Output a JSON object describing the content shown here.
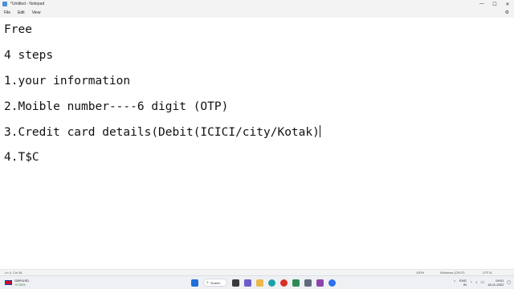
{
  "window": {
    "title": "*Untitled - Notepad",
    "controls": {
      "minimize": "—",
      "maximize": "☐",
      "close": "✕"
    }
  },
  "menu": {
    "file": "File",
    "edit": "Edit",
    "view": "View",
    "settings_icon": "gear-icon"
  },
  "document": {
    "lines": [
      "Free",
      "4 steps",
      "1.your information",
      "2.Moible number----6 digit (OTP)",
      "3.Credit card details(Debit(ICICI/city/Kotak)",
      "4.T$C"
    ]
  },
  "status": {
    "position": "Ln 4, Col 46",
    "zoom": "100%",
    "line_ending": "Windows (CRLF)",
    "encoding": "UTF-8"
  },
  "taskbar": {
    "weather_title": "GBP/USD",
    "weather_value": "+0.30%",
    "search_label": "Search",
    "colors": {
      "start": "#1e6fd9",
      "accent": "#2e7d32"
    }
  },
  "tray": {
    "language_line1": "ENG",
    "language_line2": "IN",
    "time": "09:01",
    "date": "18-11-2022"
  }
}
